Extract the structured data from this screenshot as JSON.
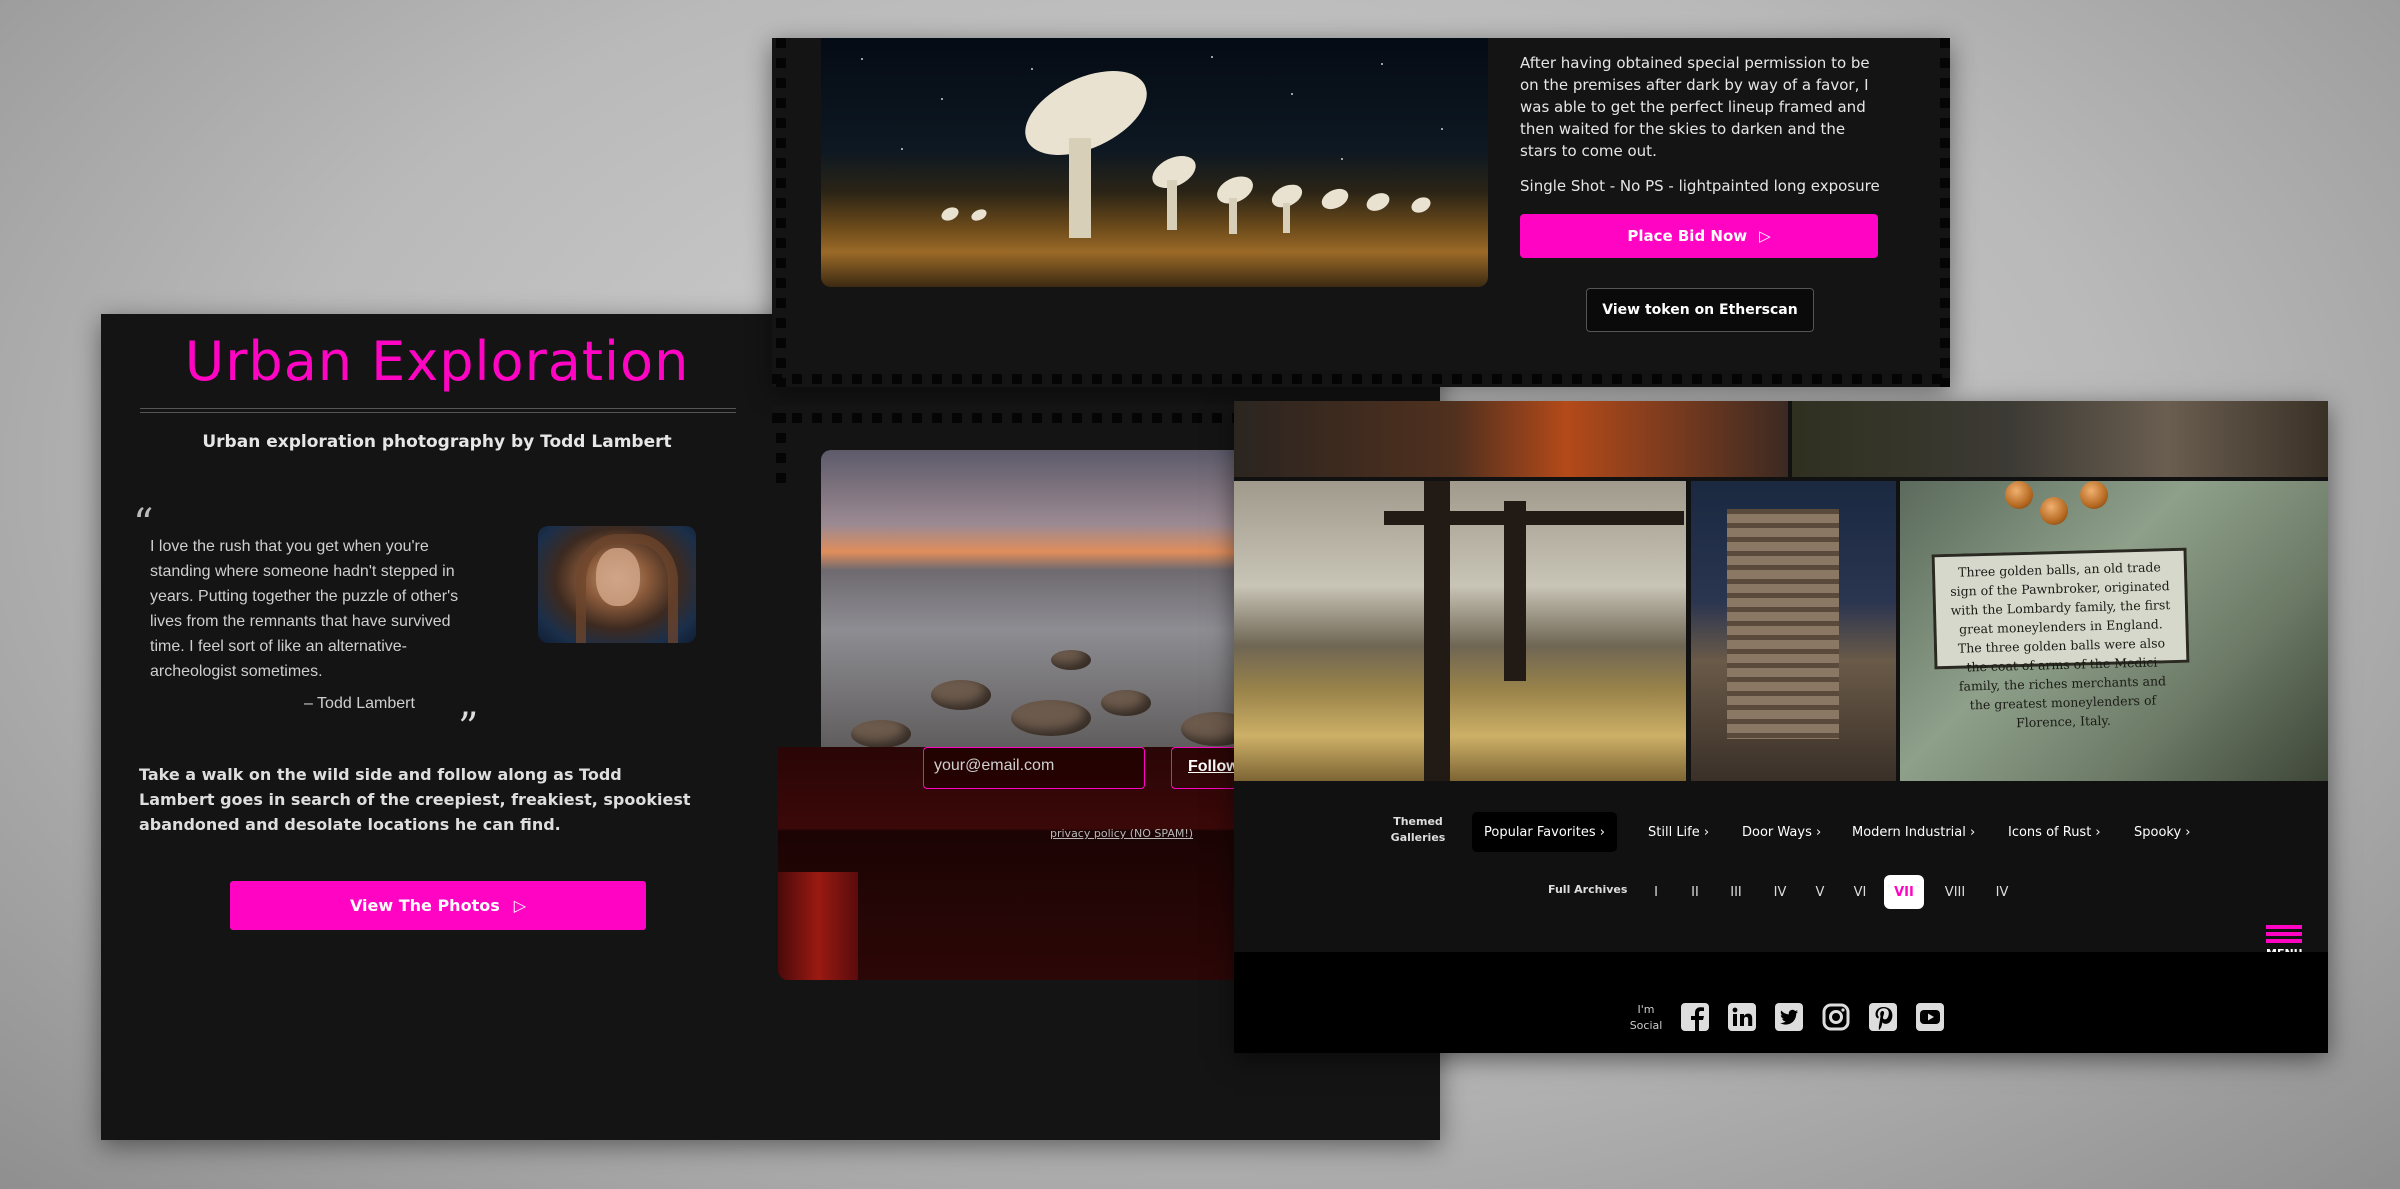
{
  "left": {
    "title": "Urban Exploration",
    "subtitle": "Urban exploration photography by Todd Lambert",
    "quote_open": "“",
    "quote": "I love the rush that you get when you're standing where someone hadn't stepped in years. Putting together the puzzle of other's lives from the remnants that have survived time. I feel sort of like an alternative-archeologist sometimes.",
    "author": "– Todd Lambert",
    "quote_close": "”",
    "intro": "Take a walk on the wild side and follow along as Todd Lambert goes in search of the creepiest, freakiest, spookiest abandoned and desolate locations he can find.",
    "button_label": "View The Photos",
    "button_icon": "▷"
  },
  "listing": {
    "description": "After having obtained special permission to be on the premises after dark by way of a favor, I was able to get the perfect lineup framed and then waited for the skies to darken and the stars to come out.",
    "shot_info": "Single Shot - No PS - lightpainted long exposure",
    "bid_label": "Place Bid Now",
    "bid_icon": "▷",
    "etherscan_label": "View token on Etherscan"
  },
  "newsletter": {
    "email_placeholder": "your@email.com",
    "follow_label": "Follow",
    "privacy_label": "privacy policy (NO SPAM!)"
  },
  "gallery": {
    "sign_text": "Three golden balls, an old trade sign of the Pawnbroker, originated with the Lombardy family, the first great moneylenders in England. The three golden balls were also the coat of arms of the Medici family, the riches merchants and the greatest moneylenders of Florence, Italy.",
    "themed_label": "Themed Galleries",
    "themed": [
      "Popular Favorites ›",
      "Still Life ›",
      "Door Ways ›",
      "Modern Industrial ›",
      "Icons of Rust ›",
      "Spooky ›"
    ],
    "themed_active": "Popular Favorites ›",
    "archives_label": "Full Archives",
    "archives": [
      "I",
      "II",
      "III",
      "IV",
      "V",
      "VI",
      "VII",
      "VIII",
      "IV"
    ],
    "archives_active": "VII",
    "menu_label": "MENU",
    "social_label": "I'm Social",
    "social_icons": [
      "facebook-icon",
      "linkedin-icon",
      "twitter-icon",
      "instagram-icon",
      "pinterest-icon",
      "youtube-icon"
    ]
  },
  "colors": {
    "accent": "#ff05c3",
    "panel": "#141414"
  }
}
